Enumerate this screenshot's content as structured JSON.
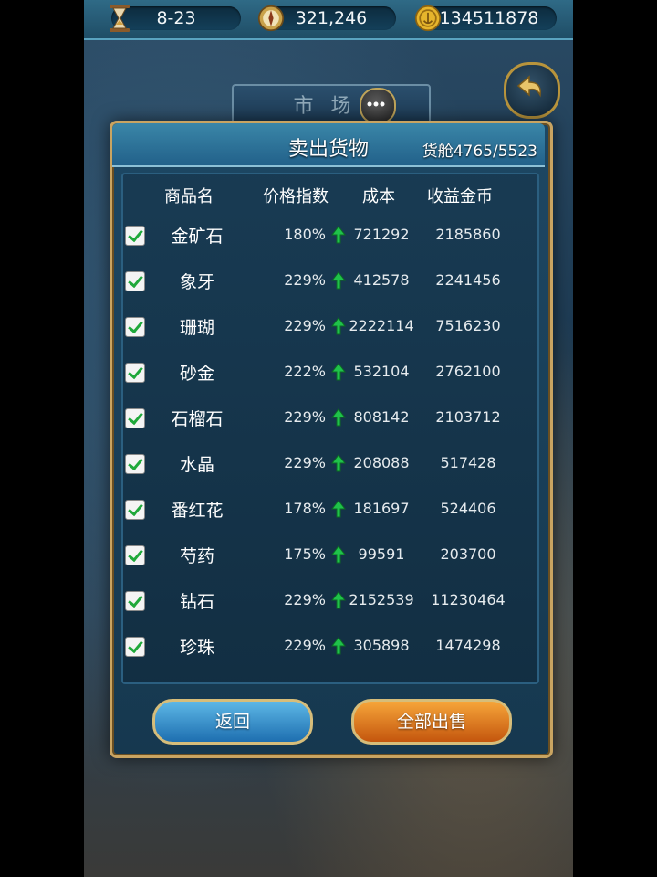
{
  "topbar": {
    "date": "8-23",
    "compass_value": "321,246",
    "gold": "134511878",
    "icons": [
      "hourglass-icon",
      "compass-icon",
      "gold-coin-icon"
    ]
  },
  "market": {
    "title": "市 场"
  },
  "dialog": {
    "title": "卖出货物",
    "cargo": "货舱4765/5523",
    "headers": {
      "name": "商品名",
      "price_index": "价格指数",
      "cost": "成本",
      "profit": "收益金币"
    },
    "rows": [
      {
        "checked": true,
        "name": "金矿石",
        "price_index": "180%",
        "trend": "up",
        "cost": "721292",
        "profit": "2185860"
      },
      {
        "checked": true,
        "name": "象牙",
        "price_index": "229%",
        "trend": "up",
        "cost": "412578",
        "profit": "2241456"
      },
      {
        "checked": true,
        "name": "珊瑚",
        "price_index": "229%",
        "trend": "up",
        "cost": "2222114",
        "profit": "7516230"
      },
      {
        "checked": true,
        "name": "砂金",
        "price_index": "222%",
        "trend": "up",
        "cost": "532104",
        "profit": "2762100"
      },
      {
        "checked": true,
        "name": "石榴石",
        "price_index": "229%",
        "trend": "up",
        "cost": "808142",
        "profit": "2103712"
      },
      {
        "checked": true,
        "name": "水晶",
        "price_index": "229%",
        "trend": "up",
        "cost": "208088",
        "profit": "517428"
      },
      {
        "checked": true,
        "name": "番红花",
        "price_index": "178%",
        "trend": "up",
        "cost": "181697",
        "profit": "524406"
      },
      {
        "checked": true,
        "name": "芍药",
        "price_index": "175%",
        "trend": "up",
        "cost": "99591",
        "profit": "203700"
      },
      {
        "checked": true,
        "name": "钻石",
        "price_index": "229%",
        "trend": "up",
        "cost": "2152539",
        "profit": "11230464"
      },
      {
        "checked": true,
        "name": "珍珠",
        "price_index": "229%",
        "trend": "up",
        "cost": "305898",
        "profit": "1474298"
      }
    ],
    "back_label": "返回",
    "sell_all_label": "全部出售"
  },
  "colors": {
    "frame_gold": "#c9a461",
    "arrow_green": "#1fc24a",
    "sell_orange": "#e07a1c",
    "back_blue": "#2e8fd0"
  }
}
